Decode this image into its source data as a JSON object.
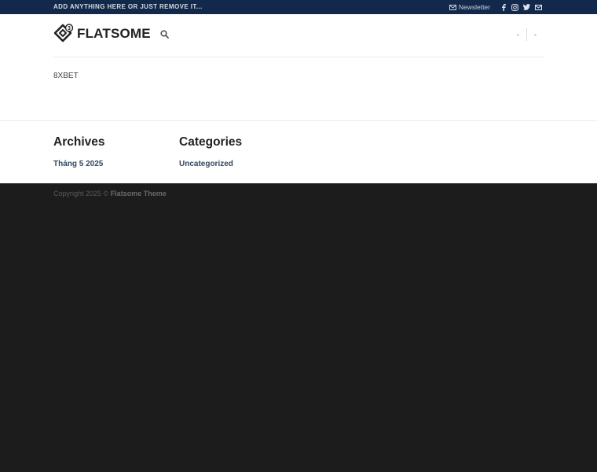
{
  "topbar": {
    "message": "ADD ANYTHING HERE OR JUST REMOVE IT...",
    "newsletter_label": "Newsletter",
    "social_icons": [
      "facebook-icon",
      "instagram-icon",
      "twitter-icon",
      "email-icon"
    ]
  },
  "header": {
    "logo_text": "FLATSOME",
    "logo_badge": "3",
    "nav_right": [
      "-",
      "-"
    ]
  },
  "main": {
    "post_title": "8XBET"
  },
  "widgets": {
    "archives": {
      "title": "Archives",
      "items": [
        "Tháng 5 2025"
      ]
    },
    "categories": {
      "title": "Categories",
      "items": [
        "Uncategorized"
      ]
    }
  },
  "footer": {
    "copyright_prefix": "Copyright 2025 ©",
    "copyright_brand": "Flatsome Theme"
  },
  "colors": {
    "topbar_bg": "#13294b",
    "link": "#334862",
    "footer_bg": "#1c1c1c"
  }
}
